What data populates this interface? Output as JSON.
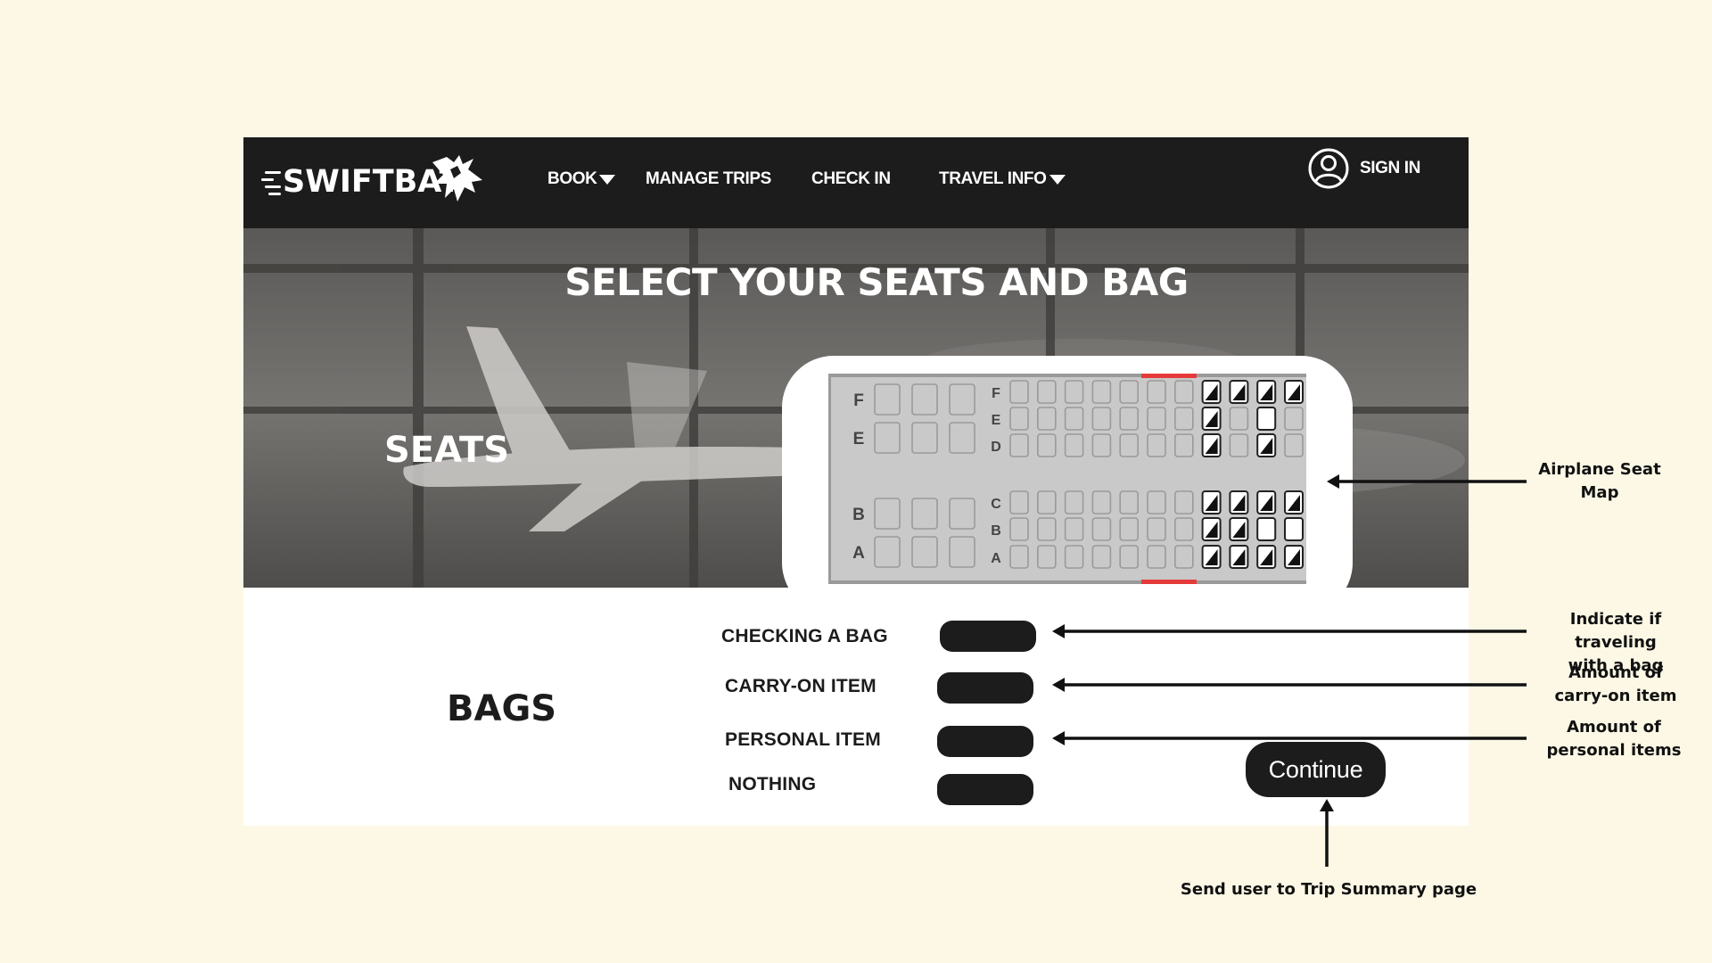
{
  "colors": {
    "page_bg": "#fcf8e5",
    "nav_bg": "#1c1c1c",
    "accent_red": "#e63a3a",
    "seat_gray": "#c9c9c9"
  },
  "nav": {
    "brand": "SWIFTBAT",
    "items": [
      {
        "label": "BOOK",
        "has_dropdown": true
      },
      {
        "label": "MANAGE TRIPS",
        "has_dropdown": false
      },
      {
        "label": "CHECK IN",
        "has_dropdown": false
      },
      {
        "label": "TRAVEL INFO",
        "has_dropdown": true
      }
    ],
    "sign_in": "SIGN IN",
    "icons": {
      "brand": "bat-icon",
      "account": "user-icon",
      "dropdown": "caret-down-icon"
    }
  },
  "hero": {
    "title": "SELECT YOUR SEATS AND BAG",
    "seats_label": "SEATS",
    "seatmap": {
      "front_rows_top": [
        "F",
        "E"
      ],
      "front_rows_bottom": [
        "B",
        "A"
      ],
      "rows_top": [
        "F",
        "E",
        "D"
      ],
      "rows_bottom": [
        "C",
        "B",
        "A"
      ]
    }
  },
  "bags": {
    "title": "BAGS",
    "options": [
      {
        "label": "CHECKING A BAG"
      },
      {
        "label": "CARRY-ON ITEM"
      },
      {
        "label": "PERSONAL ITEM"
      },
      {
        "label": "NOTHING"
      }
    ],
    "continue": "Continue"
  },
  "annotations": {
    "seat_map": [
      "Airplane Seat",
      "Map"
    ],
    "checking_bag": [
      "Indicate if traveling",
      "with a bag"
    ],
    "carry_on": [
      "Amount of",
      "carry-on item"
    ],
    "personal": [
      "Amount of",
      "personal items"
    ],
    "continue": "Send user to  Trip Summary page"
  }
}
